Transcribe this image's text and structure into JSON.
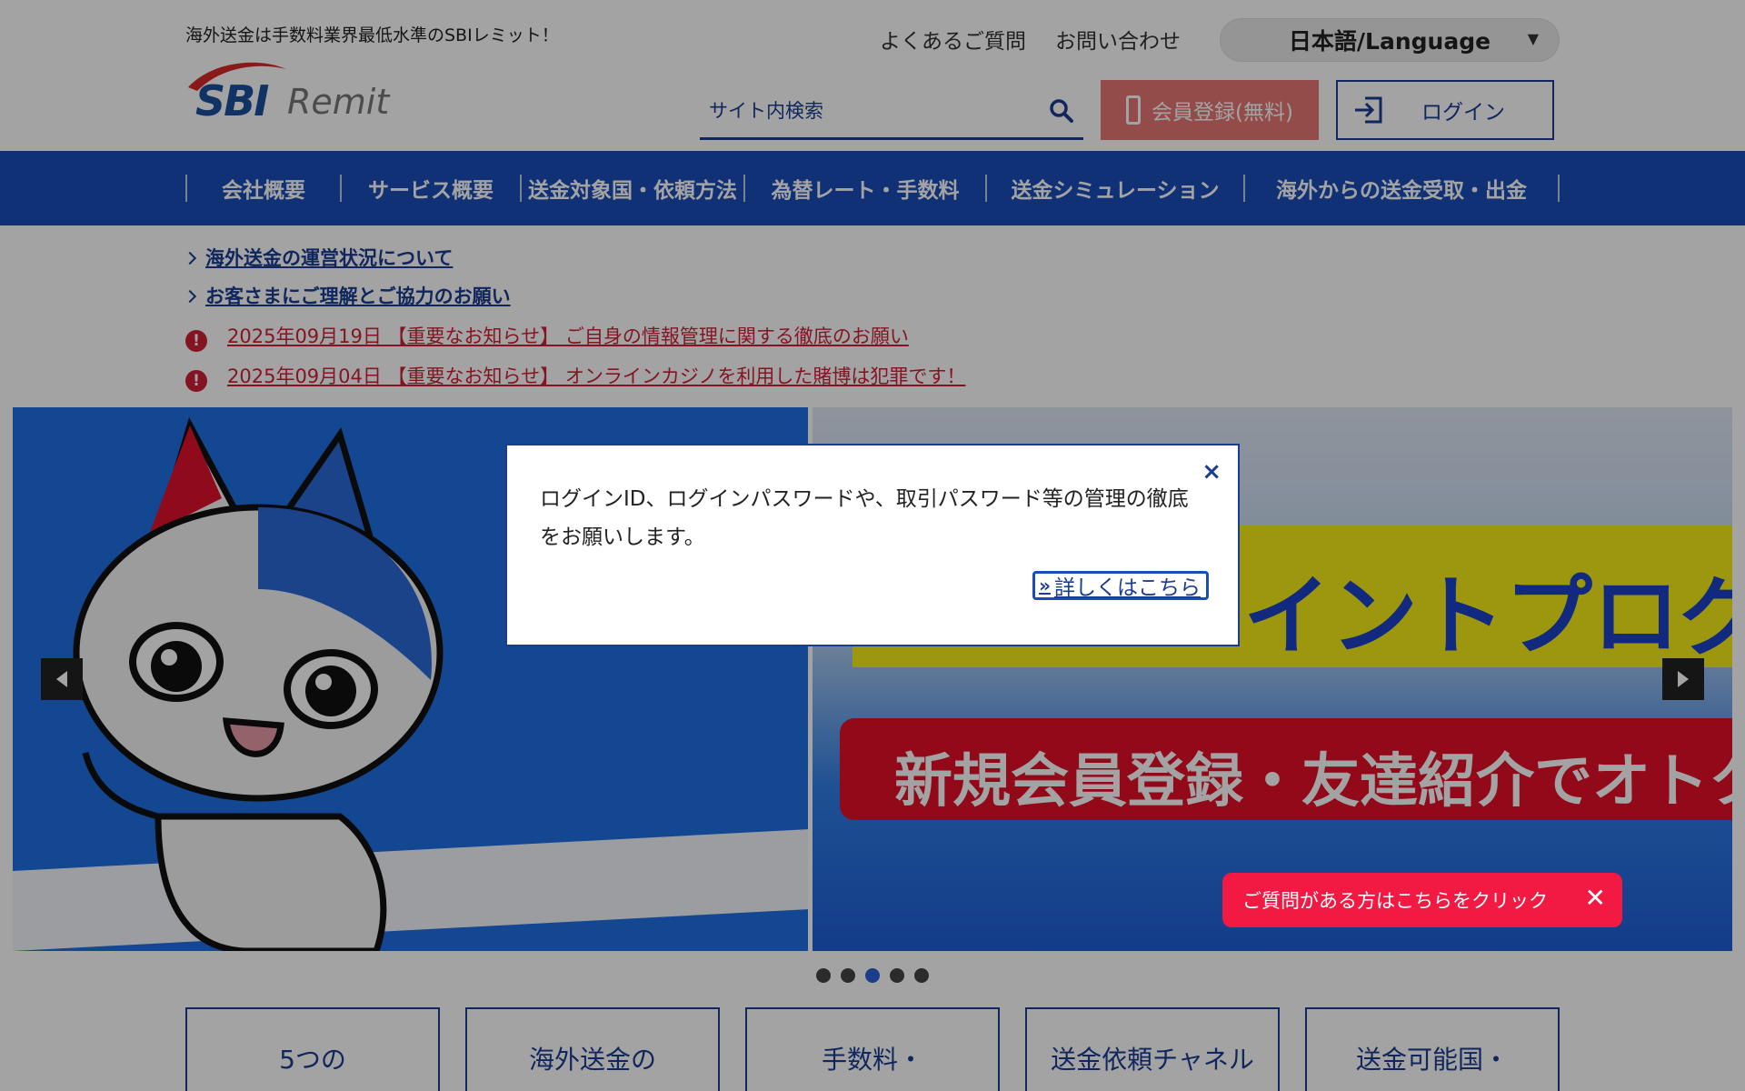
{
  "header": {
    "tagline": "海外送金は手数料業界最低水準のSBIレミット！",
    "logo_sbi": "SBI",
    "logo_remit": "Remit",
    "top_links": [
      "よくあるご質問",
      "お問い合わせ"
    ],
    "language_select": "日本語/Language",
    "search_placeholder": "サイト内検索",
    "register_button": "会員登録(無料)",
    "login_button": "ログイン"
  },
  "nav": {
    "items": [
      "会社概要",
      "サービス概要",
      "送金対象国・依頼方法",
      "為替レート・手数料",
      "送金シミュレーション",
      "海外からの送金受取・出金"
    ]
  },
  "notices": {
    "links": [
      "海外送金の運営状況について",
      "お客さまにご理解とご協力のお願い"
    ],
    "alerts": [
      "2025年09月19日 【重要なお知らせ】 ご自身の情報管理に関する徹底のお願い",
      "2025年09月04日 【重要なお知らせ】 オンラインカジノを利用した賭博は犯罪です！"
    ],
    "alert_mark": "!"
  },
  "slider": {
    "banner_text_1": "イントプログラ",
    "banner_text_2": "新規会員登録・友達紹介でオトクに",
    "dots_count": 5,
    "active_dot": 3
  },
  "cards": [
    "5つの",
    "海外送金の",
    "手数料・",
    "送金依頼チャネル",
    "送金可能国・"
  ],
  "modal": {
    "message": "ログインID、ログインパスワードや、取引パスワード等の管理の徹底をお願いします。",
    "more_link": "詳しくはこちら",
    "close_glyph": "×"
  },
  "chat": {
    "label": "ご質問がある方はこちらをクリック",
    "close_glyph": "✕"
  },
  "colors": {
    "brand_blue": "#1a4db7",
    "nav_blue": "#1a3c91",
    "register_red": "#e87875",
    "alert_red": "#d02038",
    "chat_red": "#f21a42"
  }
}
